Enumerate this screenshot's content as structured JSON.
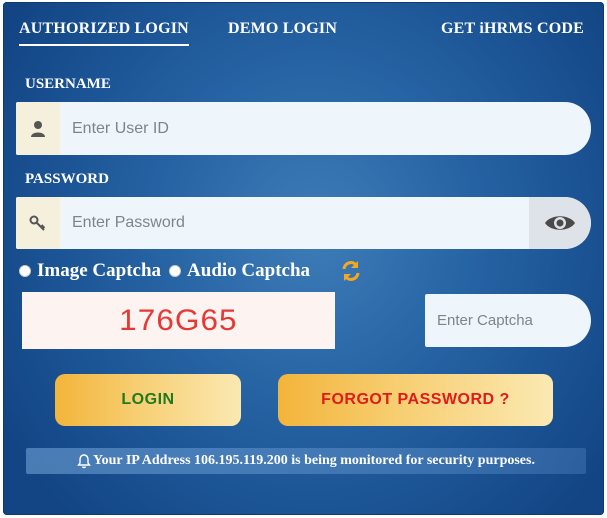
{
  "tabs": {
    "authorized": "AUTHORIZED LOGIN",
    "demo": "DEMO LOGIN",
    "code": "GET iHRMS CODE"
  },
  "username": {
    "label": "USERNAME",
    "placeholder": "Enter User ID",
    "icon": "user-icon"
  },
  "password": {
    "label": "PASSWORD",
    "placeholder": "Enter Password",
    "icon": "key-icon",
    "toggle_icon": "eye-icon"
  },
  "captcha": {
    "option_image": "Image Captcha",
    "option_audio": "Audio Captcha",
    "refresh_icon": "refresh-icon",
    "image_text": "176G65",
    "input_placeholder": "Enter Captcha"
  },
  "buttons": {
    "login": "LOGIN",
    "forgot": "FORGOT PASSWORD ?"
  },
  "notice": {
    "text": "Your IP Address 106.195.119.200 is being monitored for security purposes.",
    "icon": "bell-icon"
  },
  "colors": {
    "panel": "#2a68a8",
    "login_text": "#1f7a1f",
    "forgot_text": "#e01b1b",
    "button_gold": "#f3b43a",
    "captcha_text": "#e53935"
  }
}
